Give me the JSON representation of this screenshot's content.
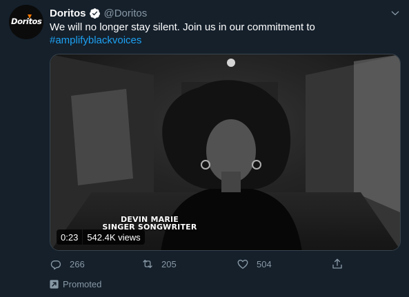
{
  "tweet": {
    "avatar": {
      "brand": "Doritos",
      "icon": "doritos-logo"
    },
    "author": {
      "display_name": "Doritos",
      "verified": true,
      "handle": "@Doritos"
    },
    "text": "We will no longer stay silent. Join us in our commitment to",
    "hashtag": "#amplifyblackvoices",
    "media": {
      "type": "video",
      "caption_name": "DEVIN MARIE",
      "caption_role": "SINGER SONGWRITER",
      "duration": "0:23",
      "views": "542.4K views"
    },
    "actions": {
      "reply_count": "266",
      "retweet_count": "205",
      "like_count": "504"
    },
    "promoted_label": "Promoted"
  },
  "colors": {
    "background": "#15202b",
    "accent": "#1da1f2",
    "secondary_text": "#8899a6",
    "border": "#38444d"
  },
  "icons": [
    "verified-badge-icon",
    "chevron-down-icon",
    "reply-icon",
    "retweet-icon",
    "like-icon",
    "share-icon",
    "promoted-icon"
  ]
}
